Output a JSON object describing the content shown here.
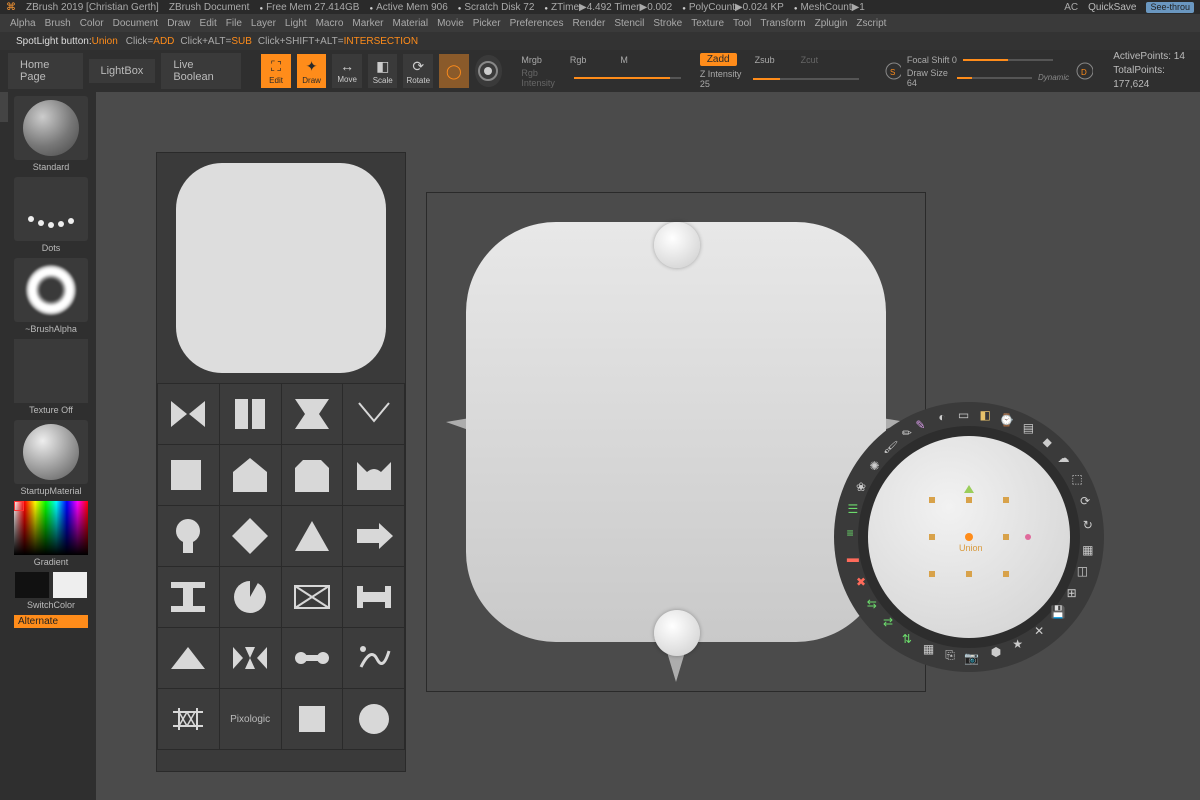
{
  "title": {
    "app": "ZBrush 2019 [Christian Gerth]",
    "doc": "ZBrush Document",
    "freemem": "Free Mem 27.414GB",
    "activemem": "Active Mem 906",
    "scratch": "Scratch Disk 72",
    "ztime": "ZTime▶4.492 Timer▶0.002",
    "poly": "PolyCount▶0.024 KP",
    "mesh": "MeshCount▶1",
    "ac": "AC",
    "quicksave": "QuickSave",
    "seethru": "See-throu"
  },
  "menu": [
    "Alpha",
    "Brush",
    "Color",
    "Document",
    "Draw",
    "Edit",
    "File",
    "Layer",
    "Light",
    "Macro",
    "Marker",
    "Material",
    "Movie",
    "Picker",
    "Preferences",
    "Render",
    "Stencil",
    "Stroke",
    "Texture",
    "Tool",
    "Transform",
    "Zplugin",
    "Zscript"
  ],
  "mode": {
    "label": "SpotLight button:",
    "value": "Union",
    "click": "Click=",
    "clickv": "ADD",
    "alt": "Click+ALT=",
    "altv": "SUB",
    "shift": "Click+SHIFT+ALT=",
    "shiftv": "INTERSECTION"
  },
  "tabs": {
    "home": "Home Page",
    "lightbox": "LightBox",
    "live": "Live Boolean"
  },
  "tools": {
    "edit": "Edit",
    "draw": "Draw",
    "move": "Move",
    "scale": "Scale",
    "rotate": "Rotate",
    "mrgb": "Mrgb",
    "rgb": "Rgb",
    "m": "M",
    "rgbint": "Rgb Intensity",
    "zadd": "Zadd",
    "zsub": "Zsub",
    "zcut": "Zcut",
    "zint": "Z Intensity 25",
    "focal": "Focal Shift 0",
    "drawsize": "Draw Size 64",
    "dynamic": "Dynamic",
    "active": "ActivePoints: 14",
    "total": "TotalPoints: 177,624"
  },
  "left": {
    "standard": "Standard",
    "dots": "Dots",
    "brushalpha": "~BrushAlpha",
    "texoff": "Texture Off",
    "startup": "StartupMaterial",
    "gradient": "Gradient",
    "switch": "SwitchColor",
    "alternate": "Alternate"
  },
  "library": {
    "pixologic": "Pixologic"
  },
  "dial": {
    "center_label": "Union"
  }
}
